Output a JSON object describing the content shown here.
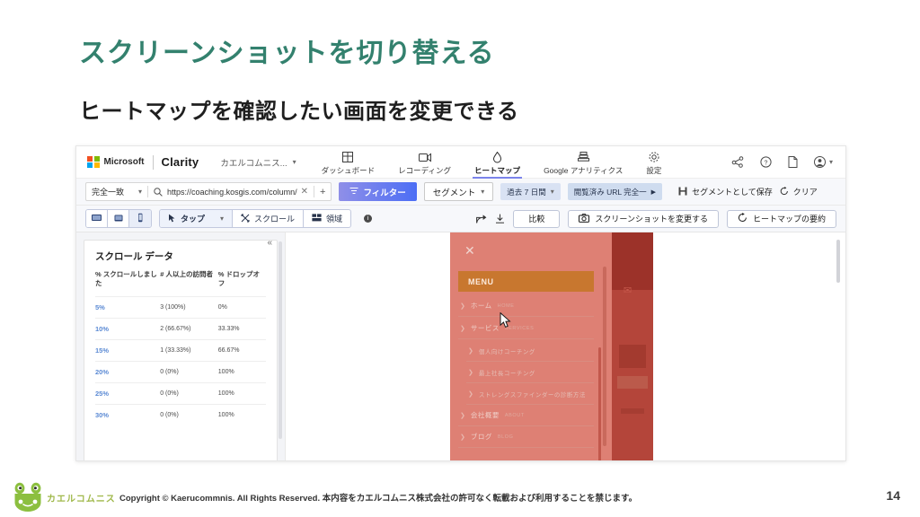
{
  "slide": {
    "title": "スクリーンショットを切り替える",
    "subtitle": "ヒートマップを確認したい画面を変更できる",
    "page_number": "14",
    "title_color": "#33816e"
  },
  "footer": {
    "brand_jp": "カエルコムニス",
    "copyright": "Copyright © Kaerucommnis. All Rights Reserved. 本内容をカエルコムニス株式会社の許可なく転載および利用することを禁じます。"
  },
  "clarity": {
    "brand": {
      "microsoft": "Microsoft",
      "product": "Clarity"
    },
    "site_picker": {
      "label": "カエルコムニス...",
      "chevron": "chevron-down-icon"
    },
    "nav_tabs": [
      {
        "label": "ダッシュボード",
        "icon": "dashboard-icon",
        "active": false
      },
      {
        "label": "レコーディング",
        "icon": "recording-icon",
        "active": false
      },
      {
        "label": "ヒートマップ",
        "icon": "heatmap-icon",
        "active": true
      },
      {
        "label": "Google アナリティクス",
        "icon": "analytics-icon",
        "active": false
      },
      {
        "label": "設定",
        "icon": "gear-icon",
        "active": false
      }
    ],
    "header_icons": [
      {
        "name": "share-icon"
      },
      {
        "name": "help-icon"
      },
      {
        "name": "document-icon"
      },
      {
        "name": "account-avatar-icon"
      }
    ],
    "filter_row": {
      "match_type": "完全一致",
      "url_value": "https://coaching.kosgis.com/column/",
      "clear_url": "✕",
      "add_url": "+",
      "filter_button": "フィルター",
      "segment_button": "セグメント",
      "date_chip": "過去 7 日間",
      "url_chip": "閲覧済み URL 完全一",
      "save_segment": "セグメントとして保存",
      "clear": "クリア"
    },
    "tool_row": {
      "devices": [
        {
          "name": "desktop-icon",
          "selected": false
        },
        {
          "name": "tablet-icon",
          "selected": false
        },
        {
          "name": "mobile-icon",
          "selected": true
        }
      ],
      "modes": [
        {
          "label": "タップ",
          "icon": "tap-icon",
          "selected": true,
          "has_chevron": true
        },
        {
          "label": "スクロール",
          "icon": "scroll-icon",
          "selected": false,
          "has_chevron": false
        },
        {
          "label": "領域",
          "icon": "area-icon",
          "selected": false,
          "has_chevron": false
        }
      ],
      "info": "i",
      "share_icon": "share-export-icon",
      "download_icon": "download-icon",
      "compare": "比較",
      "change_screenshot": "スクリーンショットを変更する",
      "heatmap_summary": "ヒートマップの要約"
    },
    "scroll_panel": {
      "title": "スクロール データ",
      "collapse": "«",
      "columns": [
        "% スクロールしました",
        "# 人以上の訪問者",
        "% ドロップオフ"
      ],
      "rows": [
        [
          "5%",
          "3 (100%)",
          "0%"
        ],
        [
          "10%",
          "2 (66.67%)",
          "33.33%"
        ],
        [
          "15%",
          "1 (33.33%)",
          "66.67%"
        ],
        [
          "20%",
          "0 (0%)",
          "100%"
        ],
        [
          "25%",
          "0 (0%)",
          "100%"
        ],
        [
          "30%",
          "0 (0%)",
          "100%"
        ]
      ]
    },
    "preview": {
      "close": "✕",
      "menu_header": "MENU",
      "menu_items": [
        {
          "ja": "ホーム",
          "en": "HOME",
          "sub": false
        },
        {
          "ja": "サービス",
          "en": "SERVICES",
          "sub": false
        },
        {
          "ja": "個人向けコーチング",
          "en": "",
          "sub": true
        },
        {
          "ja": "最上社長コーチング",
          "en": "",
          "sub": true
        },
        {
          "ja": "ストレングスファインダーの診断方法",
          "en": "",
          "sub": true
        },
        {
          "ja": "会社概要",
          "en": "ABOUT",
          "sub": false
        },
        {
          "ja": "ブログ",
          "en": "BLOG",
          "sub": false
        }
      ]
    }
  }
}
